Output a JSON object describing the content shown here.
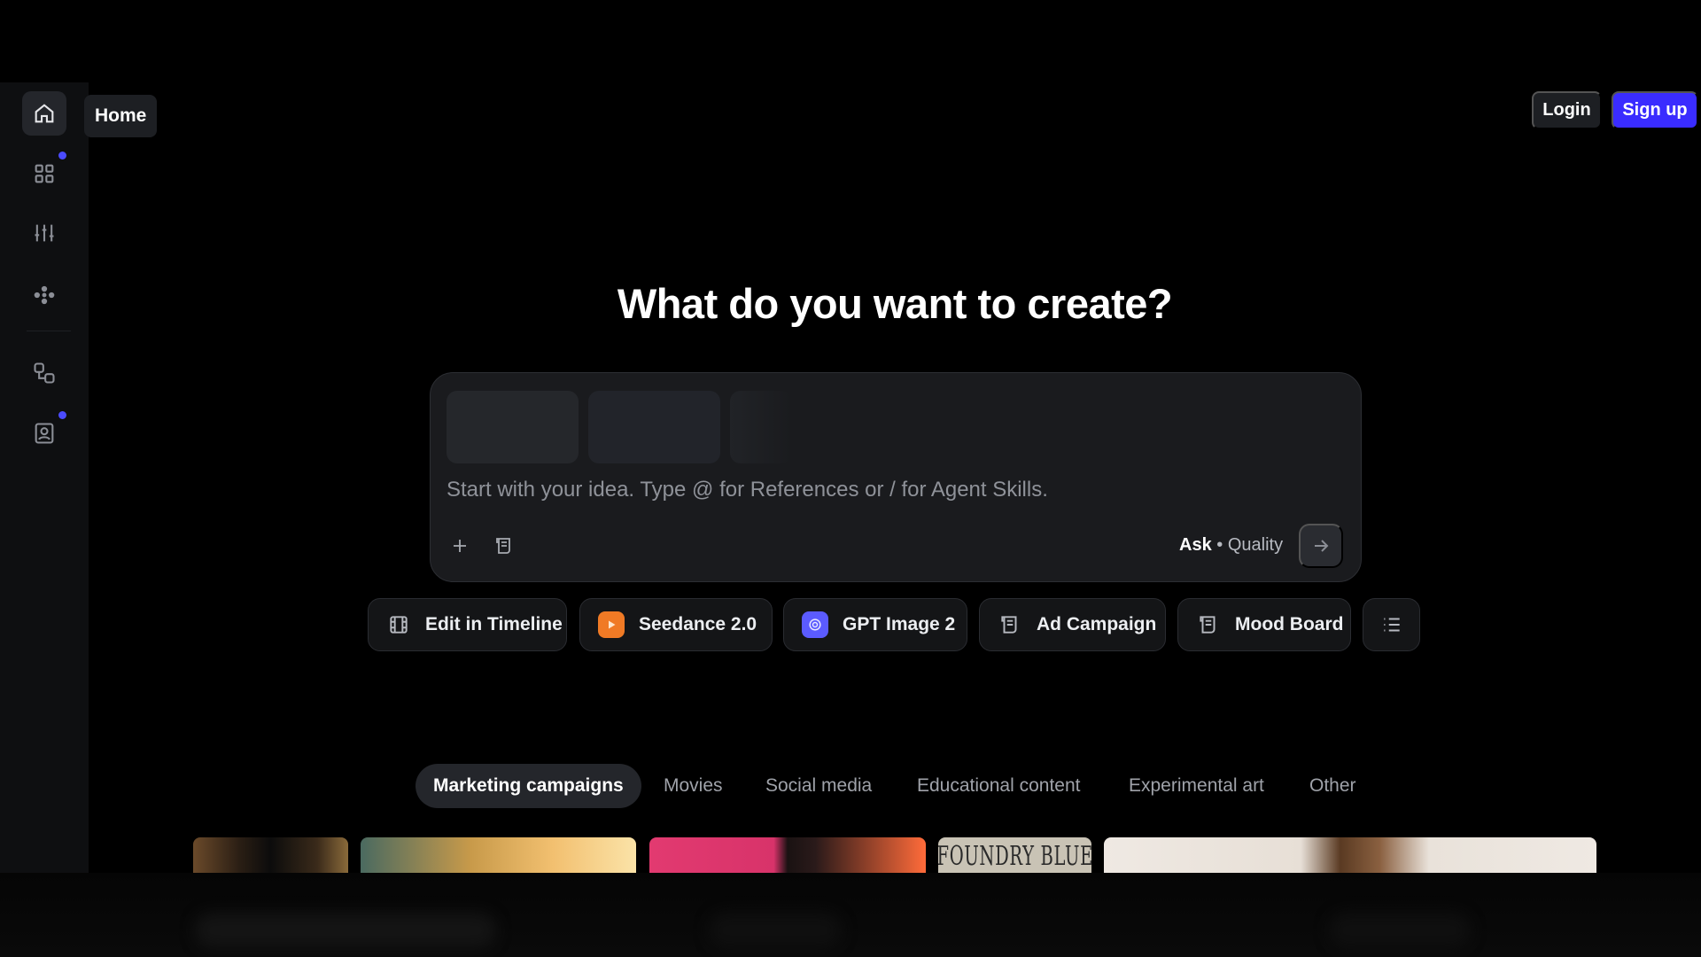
{
  "sidebar": {
    "tooltip": "Home",
    "items": [
      {
        "name": "home",
        "icon": "home-icon"
      },
      {
        "name": "apps",
        "icon": "grid-icon"
      },
      {
        "name": "adjust",
        "icon": "sliders-icon"
      },
      {
        "name": "nodes",
        "icon": "nodes-icon"
      },
      {
        "name": "workflows",
        "icon": "flow-icon"
      },
      {
        "name": "profile",
        "icon": "profile-icon"
      }
    ],
    "notification_color": "#4b4bff"
  },
  "header": {
    "login_label": "Login",
    "signup_label": "Sign up",
    "signup_color": "#3a2cff"
  },
  "hero": {
    "headline": "What do you want to create?"
  },
  "prompt": {
    "placeholder": "Start with your idea. Type @ for References or / for Agent Skills.",
    "mode_primary": "Ask",
    "mode_separator": " • ",
    "mode_secondary": "Quality"
  },
  "chips": [
    {
      "label": "Edit in Timeline",
      "icon": "film-icon"
    },
    {
      "label": "Seedance 2.0",
      "icon": "seedance-icon",
      "color": "#f07a25"
    },
    {
      "label": "GPT Image 2",
      "icon": "gpt-icon",
      "color": "#5b5bff"
    },
    {
      "label": "Ad Campaign",
      "icon": "scroll-icon"
    },
    {
      "label": "Mood Board",
      "icon": "scroll-icon"
    },
    {
      "label": "",
      "icon": "list-icon"
    }
  ],
  "tabs": [
    {
      "label": "Marketing campaigns",
      "active": true
    },
    {
      "label": "Movies"
    },
    {
      "label": "Social media"
    },
    {
      "label": "Educational content"
    },
    {
      "label": "Experimental art"
    },
    {
      "label": "Other"
    }
  ],
  "gallery": {
    "card_4_text": "FOUNDRY BLUE"
  }
}
